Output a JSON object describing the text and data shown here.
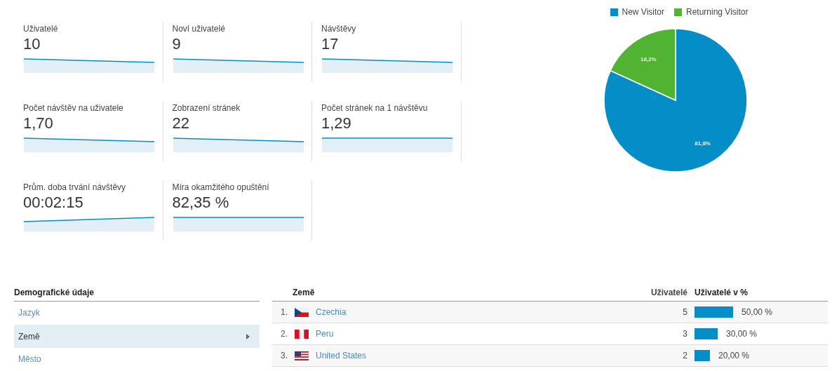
{
  "metrics": [
    {
      "label": "Uživatelé",
      "value": "10"
    },
    {
      "label": "Noví uživatelé",
      "value": "9"
    },
    {
      "label": "Návštěvy",
      "value": "17"
    },
    {
      "label": "Počet návštěv na uživatele",
      "value": "1,70"
    },
    {
      "label": "Zobrazení stránek",
      "value": "22"
    },
    {
      "label": "Počet stránek na 1 návštěvu",
      "value": "1,29"
    },
    {
      "label": "Prům. doba trvání návštěvy",
      "value": "00:02:15"
    },
    {
      "label": "Míra okamžitého opuštění",
      "value": "82,35 %"
    }
  ],
  "visitor_chart": {
    "chart_data": {
      "type": "pie",
      "categories": [
        "New Visitor",
        "Returning Visitor"
      ],
      "values": [
        81.8,
        18.2
      ],
      "colors": [
        "#058dc7",
        "#50b432"
      ],
      "value_labels": [
        "81,8%",
        "18,2%"
      ]
    }
  },
  "demographics": {
    "heading": "Demografické údaje",
    "items": [
      {
        "label": "Jazyk",
        "selected": false
      },
      {
        "label": "Země",
        "selected": true
      },
      {
        "label": "Město",
        "selected": false
      }
    ]
  },
  "table": {
    "columns": [
      "Země",
      "Uživatelé",
      "Uživatelé v %"
    ],
    "rows": [
      {
        "rank": "1.",
        "country": "Czechia",
        "users": "5",
        "percent": "50,00 %"
      },
      {
        "rank": "2.",
        "country": "Peru",
        "users": "3",
        "percent": "30,00 %"
      },
      {
        "rank": "3.",
        "country": "United States",
        "users": "2",
        "percent": "20,00 %"
      }
    ]
  }
}
